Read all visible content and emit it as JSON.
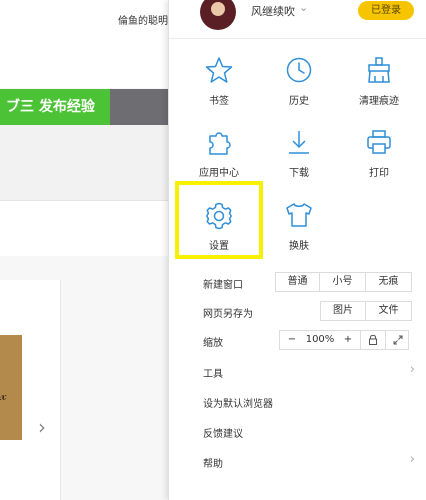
{
  "background": {
    "top_text": "倫鱼的聪明",
    "green_button": "ブ三 发布经验"
  },
  "menu": {
    "user": {
      "name": "风继续吹",
      "caret": "⌄",
      "login_status": "已登录"
    },
    "grid": [
      {
        "label": "书签",
        "icon": "star-icon"
      },
      {
        "label": "历史",
        "icon": "clock-icon"
      },
      {
        "label": "清理痕迹",
        "icon": "broom-icon"
      },
      {
        "label": "应用中心",
        "icon": "puzzle-icon"
      },
      {
        "label": "下载",
        "icon": "download-icon"
      },
      {
        "label": "打印",
        "icon": "printer-icon"
      },
      {
        "label": "设置",
        "icon": "gear-icon"
      },
      {
        "label": "换肤",
        "icon": "shirt-icon"
      }
    ],
    "new_window": {
      "label": "新建窗口",
      "options": [
        "普通",
        "小号",
        "无痕"
      ]
    },
    "save_as": {
      "label": "网页另存为",
      "options": [
        "图片",
        "文件"
      ]
    },
    "zoom": {
      "label": "缩放",
      "minus": "−",
      "value": "100%",
      "plus": "+"
    },
    "items": [
      {
        "label": "工具",
        "chevron": "›"
      },
      {
        "label": "设为默认浏览器",
        "chevron": ""
      },
      {
        "label": "反馈建议",
        "chevron": ""
      },
      {
        "label": "帮助",
        "chevron": "›"
      }
    ],
    "accent_color": "#2f8fd8",
    "highlight_color": "#f7f000",
    "badge_color": "#f7c500"
  }
}
